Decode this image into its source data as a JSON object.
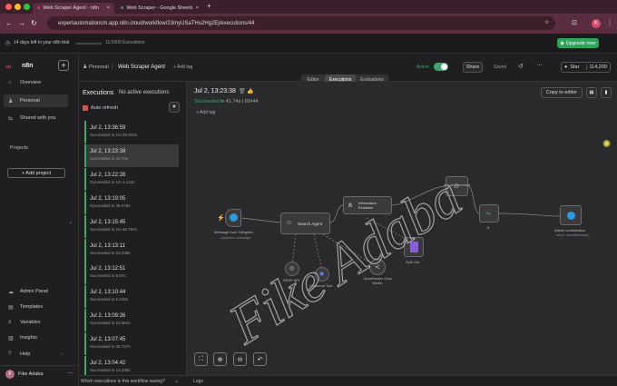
{
  "browser": {
    "tabs": [
      {
        "label": "Web Scraper Agent - n8n",
        "active": true
      },
      {
        "label": "Web Scraper - Google Sheets",
        "active": false
      }
    ],
    "url": "expertautomationcm.app.n8n.cloud/workflow/23myUSaTHu2Hg2Ej/executions/44",
    "profile_initial": "K"
  },
  "trial": {
    "days_left": "14 days left in your n8n trial",
    "executions": "11/1000 Executions",
    "upgrade": "Upgrade now"
  },
  "sidebar": {
    "brand": "n8n",
    "items": [
      {
        "label": "Overview",
        "icon": "home-icon"
      },
      {
        "label": "Personal",
        "icon": "user-icon"
      },
      {
        "label": "Shared with you",
        "icon": "share-icon"
      }
    ],
    "projects_label": "Projects",
    "add_project": "+ Add project",
    "bottom_items": [
      {
        "label": "Admin Panel",
        "icon": "cloud-icon"
      },
      {
        "label": "Templates",
        "icon": "template-icon"
      },
      {
        "label": "Variables",
        "icon": "variables-icon"
      },
      {
        "label": "Insights",
        "icon": "insights-icon"
      },
      {
        "label": "Help",
        "icon": "help-icon"
      }
    ],
    "user": "Fike Adaba"
  },
  "header": {
    "breadcrumb_owner": "Personal",
    "workflow_name": "Web Scraper Agent",
    "add_tag": "+ Add tag",
    "active_label": "Active",
    "share": "Share",
    "saved": "Saved",
    "star": "Star",
    "star_count": "114,209",
    "tabs": [
      "Editor",
      "Executions",
      "Evaluations"
    ],
    "active_tab": "Executions"
  },
  "executions": {
    "title": "Executions",
    "no_active": "No active executions",
    "auto_refresh": "Auto refresh",
    "items": [
      {
        "date": "Jul 2, 13:36:59",
        "sub": "Succeeded in 1m 26.934s"
      },
      {
        "date": "Jul 2, 13:23:38",
        "sub": "Succeeded in 41.74s"
      },
      {
        "date": "Jul 2, 13:22:28",
        "sub": "Succeeded in 1m 1.144s"
      },
      {
        "date": "Jul 2, 13:19:05",
        "sub": "Succeeded in 49.475s"
      },
      {
        "date": "Jul 2, 13:15:45",
        "sub": "Succeeded in 1m 46.794s"
      },
      {
        "date": "Jul 2, 13:13:11",
        "sub": "Succeeded in 23.238s"
      },
      {
        "date": "Jul 2, 13:12:51",
        "sub": "Succeeded in 6.87s"
      },
      {
        "date": "Jul 2, 13:10:44",
        "sub": "Succeeded in 8.218s"
      },
      {
        "date": "Jul 2, 13:09:26",
        "sub": "Succeeded in 10.361s"
      },
      {
        "date": "Jul 2, 13:07:45",
        "sub": "Succeeded in 38.757s"
      },
      {
        "date": "Jul 2, 13:04:42",
        "sub": "Succeeded in 13.335s"
      }
    ],
    "selected_index": 1
  },
  "detail": {
    "date": "Jul 2, 13:23:38",
    "status": "Succeeded",
    "status_rest": " in 41.74s | ID#44",
    "add_tag": "+ Add tag",
    "copy_to_editor": "Copy to editor"
  },
  "nodes": [
    {
      "label": "Message from Telegram",
      "sub": "Updates: message"
    },
    {
      "label": "Search Agent",
      "sub": ""
    },
    {
      "label": "Information Extractor",
      "sub": ""
    },
    {
      "label": "Article Research",
      "sub": ""
    },
    {
      "label": "If",
      "sub": ""
    },
    {
      "label": "Article confirmation",
      "sub": "send: sendMessage"
    },
    {
      "label": "SERP API",
      "sub": ""
    },
    {
      "label": "Chatwoot Tool",
      "sub": ""
    },
    {
      "label": "OpenRouter Chat Model",
      "sub": ""
    },
    {
      "label": "Split Out",
      "sub": ""
    }
  ],
  "footer": {
    "question": "Which executions is this workflow saving?",
    "logs": "Logs"
  },
  "watermark": "Fike Adaba",
  "colors": {
    "accent_green": "#3aa76d",
    "brand_pink": "#ea4b71",
    "upgrade_green": "#2aa55a"
  }
}
